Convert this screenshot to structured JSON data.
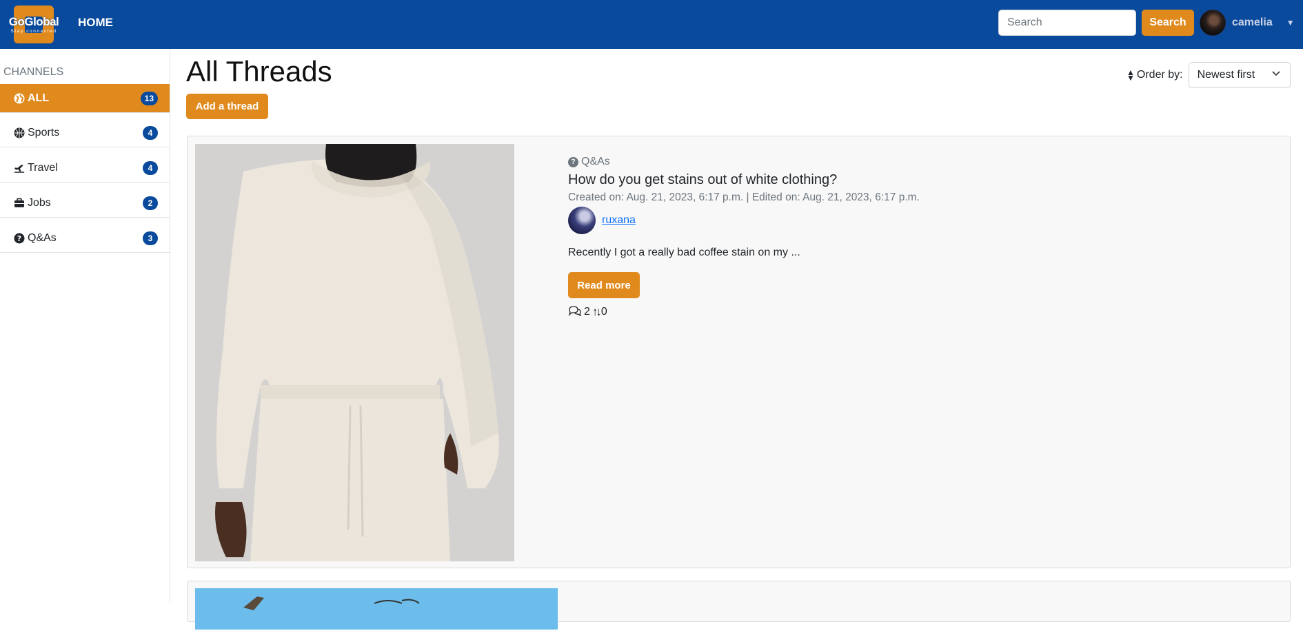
{
  "nav": {
    "logo_text": "GoGlobal",
    "logo_tagline": "Stay connected",
    "home_label": "HOME",
    "search_placeholder": "Search",
    "search_button": "Search",
    "username": "camelia"
  },
  "sidebar": {
    "title": "CHANNELS",
    "channels": [
      {
        "label": "ALL",
        "count": "13",
        "icon": "globe-icon"
      },
      {
        "label": "Sports",
        "count": "4",
        "icon": "basketball-icon"
      },
      {
        "label": "Travel",
        "count": "4",
        "icon": "plane-icon"
      },
      {
        "label": "Jobs",
        "count": "2",
        "icon": "briefcase-icon"
      },
      {
        "label": "Q&As",
        "count": "3",
        "icon": "question-icon"
      }
    ]
  },
  "main": {
    "title": "All Threads",
    "add_thread": "Add a thread",
    "order_label": "Order by:",
    "order_value": "Newest first"
  },
  "threads": [
    {
      "category": "Q&As",
      "title": "How do you get stains out of white clothing?",
      "meta": "Created on: Aug. 21, 2023, 6:17 p.m. | Edited on: Aug. 21, 2023, 6:17 p.m.",
      "author": "ruxana",
      "excerpt": "Recently I got a really bad coffee stain on my ...",
      "read_more": "Read more",
      "comments": "2",
      "votes": "0"
    }
  ],
  "colors": {
    "navbar": "#0a4a9c",
    "accent": "#e08a1e",
    "badge": "#0a4a9c",
    "link": "#0d6efd"
  }
}
